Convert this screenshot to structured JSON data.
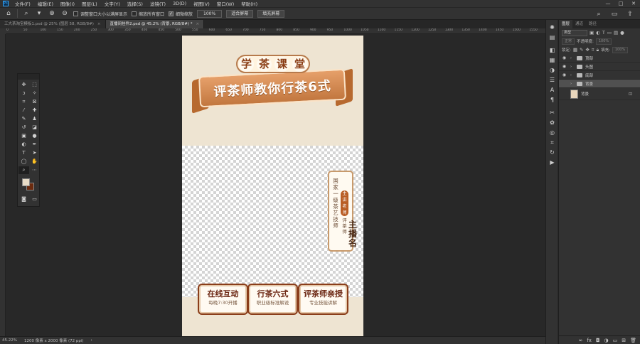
{
  "menubar": {
    "logo": "Ps",
    "items": [
      "文件(F)",
      "编辑(E)",
      "图像(I)",
      "图层(L)",
      "文字(Y)",
      "选择(S)",
      "滤镜(T)",
      "3D(D)",
      "视图(V)",
      "窗口(W)",
      "帮助(H)"
    ],
    "window_controls": [
      "—",
      "□",
      "✕"
    ]
  },
  "options": {
    "check_resize": "调整窗口大小以满屏显示",
    "check_zoom_all": "缩放所有窗口",
    "check_scrubby": "细微缩放",
    "zoom_value": "100%",
    "fit_screen": "适合屏幕",
    "fill_screen": "填充屏幕"
  },
  "tabs": [
    {
      "label": "工大茶淘宝模板1.psd @ 25% (图层 58, RGB/8#)",
      "close": "×"
    },
    {
      "label": "直播间挂件2.psd @ 45.2% (背景, RGB/8#) *",
      "close": "×"
    }
  ],
  "ruler": {
    "h_ticks": [
      "0",
      "50",
      "100",
      "150",
      "200",
      "250",
      "300",
      "350",
      "400",
      "450",
      "500",
      "550",
      "600",
      "650",
      "700",
      "750",
      "800",
      "850",
      "900",
      "950",
      "1000",
      "1050",
      "1100",
      "1150",
      "1200",
      "1250",
      "1300",
      "1350",
      "1400",
      "1450",
      "1500",
      "1550"
    ]
  },
  "canvas": {
    "title_chars": [
      "学",
      "茶",
      "课",
      "堂"
    ],
    "ribbon_text": "评茶师教你行茶6式",
    "side": {
      "col1": "国家一级茶艺技师",
      "badge": "主讲老师",
      "col2": "评茶师",
      "col3": "主播名"
    },
    "features": [
      {
        "title": "在线互动",
        "sub": "每晚7:30开播"
      },
      {
        "title": "行茶六式",
        "sub": "职业级标准解说"
      },
      {
        "title": "评茶师亲授",
        "sub": "专业技能讲解"
      }
    ]
  },
  "status": {
    "zoom": "45.22%",
    "doc_info": "1200 像素 x 2000 像素 (72 ppi)"
  },
  "layers_panel": {
    "tabs": [
      "图层",
      "通道",
      "路径"
    ],
    "kind_filter": "类型",
    "mode": "正常",
    "opacity_label": "不透明度:",
    "opacity": "100%",
    "lock_label": "锁定:",
    "fill_label": "填充:",
    "fill": "100%",
    "layers": [
      {
        "name": "顶部",
        "selected": false
      },
      {
        "name": "头图",
        "selected": false
      },
      {
        "name": "底部",
        "selected": false
      },
      {
        "name": "背景",
        "selected": true
      }
    ],
    "base_layer": "背景"
  },
  "colors": {
    "foreground": "#e8dcc7",
    "background": "#6a2a0e",
    "accent_brown": "#8a3d14",
    "ribbon_orange": "#c2773f"
  }
}
